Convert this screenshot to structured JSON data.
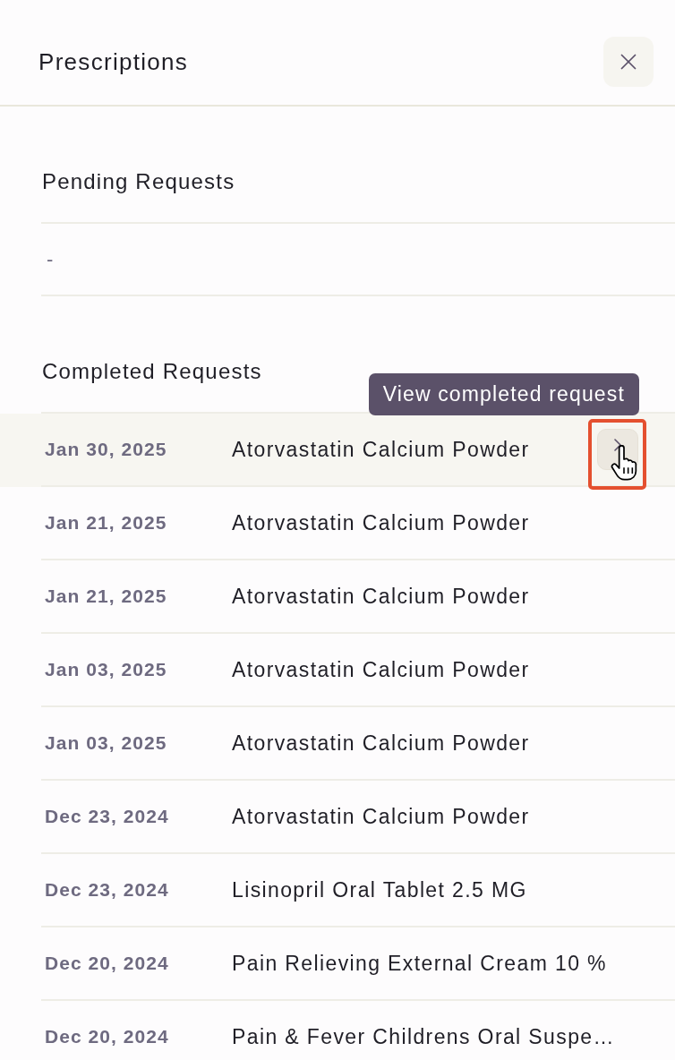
{
  "panel": {
    "title": "Prescriptions"
  },
  "pending_requests": {
    "heading": "Pending Requests",
    "empty_text": "-"
  },
  "completed_requests": {
    "heading": "Completed Requests",
    "rows": [
      {
        "date": "Jan 30, 2025",
        "name": "Atorvastatin Calcium Powder",
        "hovered": true,
        "outlined": true,
        "tooltip": "View completed request"
      },
      {
        "date": "Jan 21, 2025",
        "name": "Atorvastatin Calcium Powder",
        "hovered": false,
        "outlined": false
      },
      {
        "date": "Jan 21, 2025",
        "name": "Atorvastatin Calcium Powder",
        "hovered": false,
        "outlined": false
      },
      {
        "date": "Jan 03, 2025",
        "name": "Atorvastatin Calcium Powder",
        "hovered": false,
        "outlined": false
      },
      {
        "date": "Jan 03, 2025",
        "name": "Atorvastatin Calcium Powder",
        "hovered": false,
        "outlined": false
      },
      {
        "date": "Dec 23, 2024",
        "name": "Atorvastatin Calcium Powder",
        "hovered": false,
        "outlined": false
      },
      {
        "date": "Dec 23, 2024",
        "name": "Lisinopril Oral Tablet 2.5 MG",
        "hovered": false,
        "outlined": false
      },
      {
        "date": "Dec 20, 2024",
        "name": "Pain Relieving External Cream 10 %",
        "hovered": false,
        "outlined": false
      },
      {
        "date": "Dec 20, 2024",
        "name": "Pain & Fever Childrens Oral Suspe…",
        "hovered": false,
        "outlined": false
      }
    ]
  }
}
